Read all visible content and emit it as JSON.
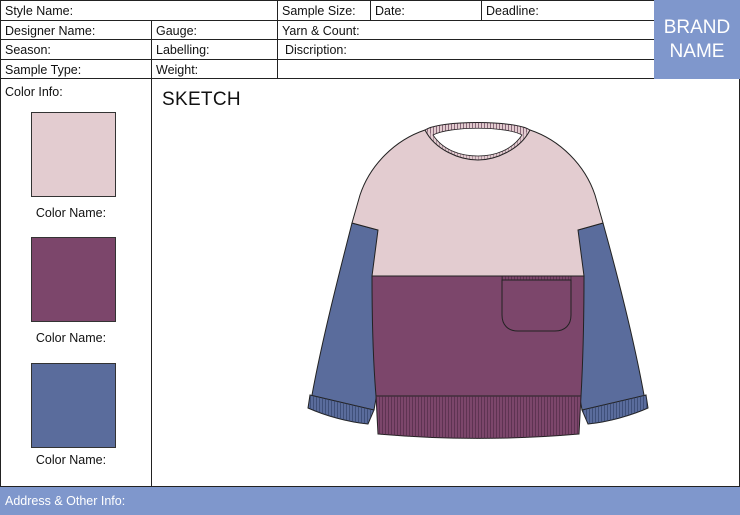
{
  "header": {
    "style_name": "Style Name:",
    "sample_size": "Sample Size:",
    "date": "Date:",
    "deadline": "Deadline:",
    "designer_name": "Designer Name:",
    "gauge": "Gauge:",
    "yarn_count": "Yarn & Count:",
    "season": "Season:",
    "labelling": "Labelling:",
    "discription": "Discription:",
    "sample_type": "Sample Type:",
    "weight": "Weight:"
  },
  "brand": {
    "line1": "BRAND",
    "line2": "NAME"
  },
  "color_info": {
    "title": "Color Info:",
    "swatches": [
      {
        "label": "Color Name:",
        "color": "#e3ccd0"
      },
      {
        "label": "Color Name:",
        "color": "#7c466b"
      },
      {
        "label": "Color Name:",
        "color": "#5a6c9c"
      }
    ]
  },
  "sketch": {
    "title": "SKETCH"
  },
  "footer": {
    "address": "Address & Other Info:"
  },
  "colors": {
    "accent": "#7f97cc",
    "pink": "#e3ccd0",
    "plum": "#7c466b",
    "slate_blue": "#5a6c9c"
  }
}
